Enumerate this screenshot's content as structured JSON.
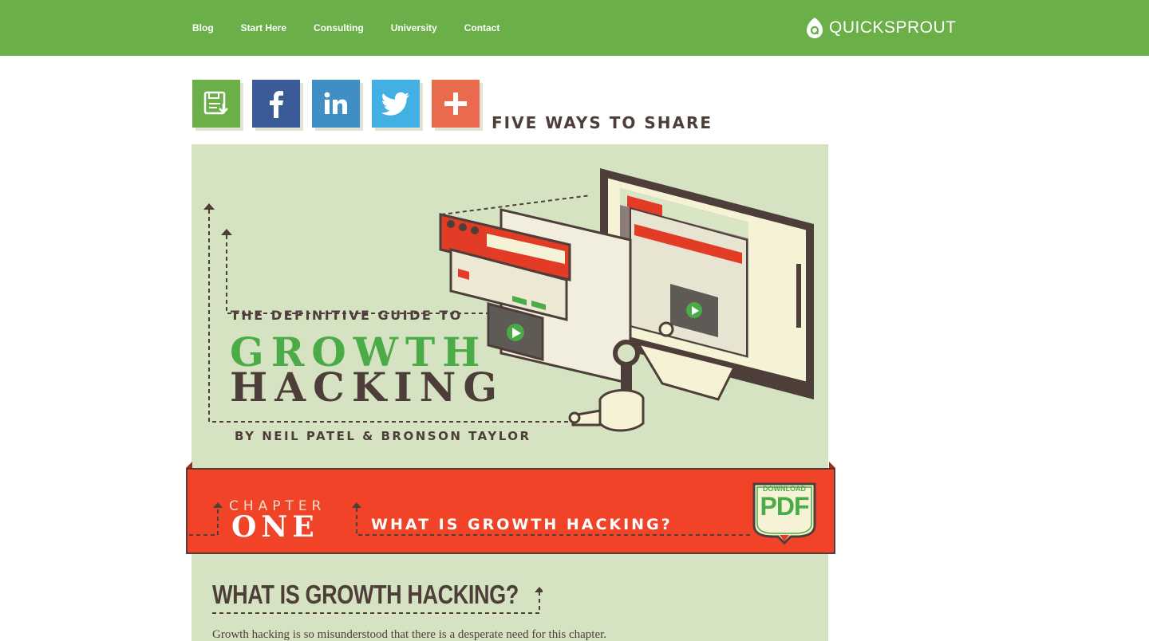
{
  "nav": {
    "items": [
      {
        "label": "Blog"
      },
      {
        "label": "Start Here"
      },
      {
        "label": "Consulting"
      },
      {
        "label": "University"
      },
      {
        "label": "Contact"
      }
    ],
    "logo_text": "QUICKSPROUT",
    "logo_icon": "q-leaf-icon"
  },
  "share": {
    "label": "FIVE WAYS TO SHARE",
    "buttons": [
      {
        "name": "save",
        "icon": "floppy-download-icon",
        "color": "#6aaf47"
      },
      {
        "name": "facebook",
        "icon": "facebook-icon",
        "color": "#3b5b98"
      },
      {
        "name": "linkedin",
        "icon": "linkedin-icon",
        "color": "#3f8ec4"
      },
      {
        "name": "twitter",
        "icon": "twitter-icon",
        "color": "#43b0e4"
      },
      {
        "name": "more",
        "icon": "plus-icon",
        "color": "#e96a4d"
      }
    ]
  },
  "hero": {
    "kicker": "THE DEFINITIVE GUIDE TO",
    "title_line1": "GROWTH",
    "title_line2": "HACKING",
    "byline": "BY NEIL PATEL & BRONSON TAYLOR",
    "background": "#d6e3c2"
  },
  "chapter": {
    "small": "CHAPTER",
    "big": "ONE",
    "title": "WHAT IS GROWTH HACKING?",
    "pdf_small": "DOWNLOAD",
    "pdf_big": "PDF",
    "color": "#f04328"
  },
  "article": {
    "heading": "WHAT IS GROWTH HACKING?",
    "intro": "Growth hacking is so misunderstood that there is a desperate need for this chapter."
  },
  "colors": {
    "nav_green": "#6aaf47",
    "ink": "#4d3e3a",
    "accent_green": "#4aab47"
  }
}
